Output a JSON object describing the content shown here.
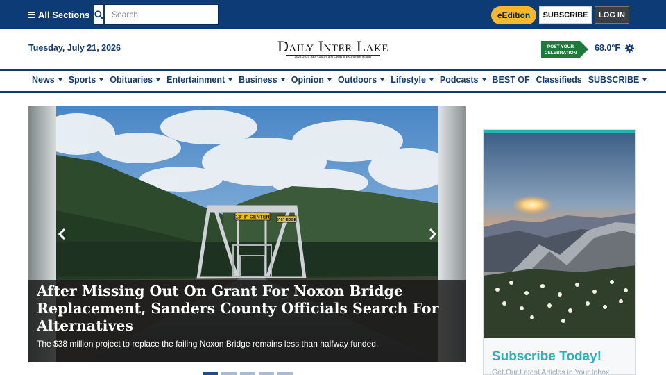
{
  "topbar": {
    "all_sections": "All Sections",
    "search_placeholder": "Search",
    "eedition": "eEdition",
    "subscribe": "SUBSCRIBE",
    "login": "LOG IN"
  },
  "header": {
    "date": "Tuesday, July 21, 2026",
    "logo_title": "Daily Inter Lake",
    "logo_subtitle": "2024-2026 Sam Gilluly and General Excellence winner",
    "promo_badge": "POST YOUR CELEBRATION",
    "temperature": "68.0°F"
  },
  "nav": {
    "items": [
      {
        "label": "News",
        "dropdown": true
      },
      {
        "label": "Sports",
        "dropdown": true
      },
      {
        "label": "Obituaries",
        "dropdown": true
      },
      {
        "label": "Entertainment",
        "dropdown": true
      },
      {
        "label": "Business",
        "dropdown": true
      },
      {
        "label": "Opinion",
        "dropdown": true
      },
      {
        "label": "Outdoors",
        "dropdown": true
      },
      {
        "label": "Lifestyle",
        "dropdown": true
      },
      {
        "label": "Podcasts",
        "dropdown": true
      },
      {
        "label": "BEST OF",
        "dropdown": false
      },
      {
        "label": "Classifieds",
        "dropdown": false
      },
      {
        "label": "SUBSCRIBE",
        "dropdown": true
      }
    ]
  },
  "hero": {
    "sign_text_1": "13' 6\" CENTER",
    "sign_text_2": "8' 6\" EDGE",
    "headline": "After Missing Out On Grant For Noxon Bridge Replacement, Sanders County Officials Search For Alternatives",
    "deck": "The $38 million project to replace the failing Noxon Bridge remains less than halfway funded.",
    "slide_count": 5,
    "active_slide": 1
  },
  "ad": {
    "title": "Subscribe Today!",
    "subtitle": "Get Our Latest Articles in Your Inbox"
  },
  "colors": {
    "brand_navy": "#0d3b75",
    "eedition_gold": "#f5b82e",
    "ad_teal": "#2bb1b8",
    "promo_green": "#1d7a3a"
  }
}
